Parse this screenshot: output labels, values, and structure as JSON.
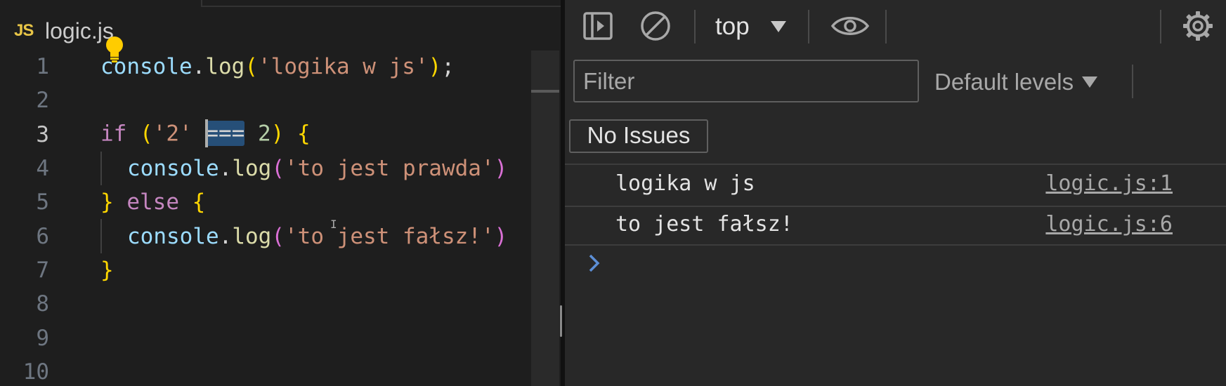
{
  "editor": {
    "tab": {
      "lang_badge": "JS",
      "filename": "logic.js"
    },
    "lines": [
      {
        "n": "1"
      },
      {
        "n": "2"
      },
      {
        "n": "3"
      },
      {
        "n": "4"
      },
      {
        "n": "5"
      },
      {
        "n": "6"
      },
      {
        "n": "7"
      },
      {
        "n": "8"
      },
      {
        "n": "9"
      },
      {
        "n": "10"
      }
    ],
    "tokens": {
      "console": "console",
      "dot": ".",
      "log": "log",
      "lparen": "(",
      "rparen": ")",
      "semi": ";",
      "str1": "'logika w js'",
      "kw_if": "if",
      "str2": "'2'",
      "op": "===",
      "num2": "2",
      "lbrace": "{",
      "rbrace": "}",
      "str_true": "'to jest prawda'",
      "kw_else": "else",
      "str_false": "'to jest fałsz!'"
    },
    "current_line": "3"
  },
  "devtools": {
    "toolbar": {
      "sidebar_icon": "sidebar-toggle-icon",
      "clear_icon": "clear-console-icon",
      "context": "top",
      "eye_icon": "live-expression-eye-icon",
      "settings_icon": "gear-icon"
    },
    "filter": {
      "placeholder": "Filter",
      "levels": "Default levels"
    },
    "issues": "No Issues",
    "messages": [
      {
        "text": "logika w js",
        "source": "logic.js:1"
      },
      {
        "text": "to jest fałsz!",
        "source": "logic.js:6"
      }
    ]
  },
  "colors": {
    "editor_bg": "#1e1e1e",
    "devtools_bg": "#282828",
    "string": "#ce9178",
    "keyword": "#c586c0",
    "variable": "#9cdcfe",
    "function": "#dcdcaa",
    "number": "#b5cea8",
    "bracket_gold": "#ffd700",
    "bracket_violet": "#da70d6",
    "selection": "#264f78",
    "prompt_chevron": "#5c8fd6"
  }
}
